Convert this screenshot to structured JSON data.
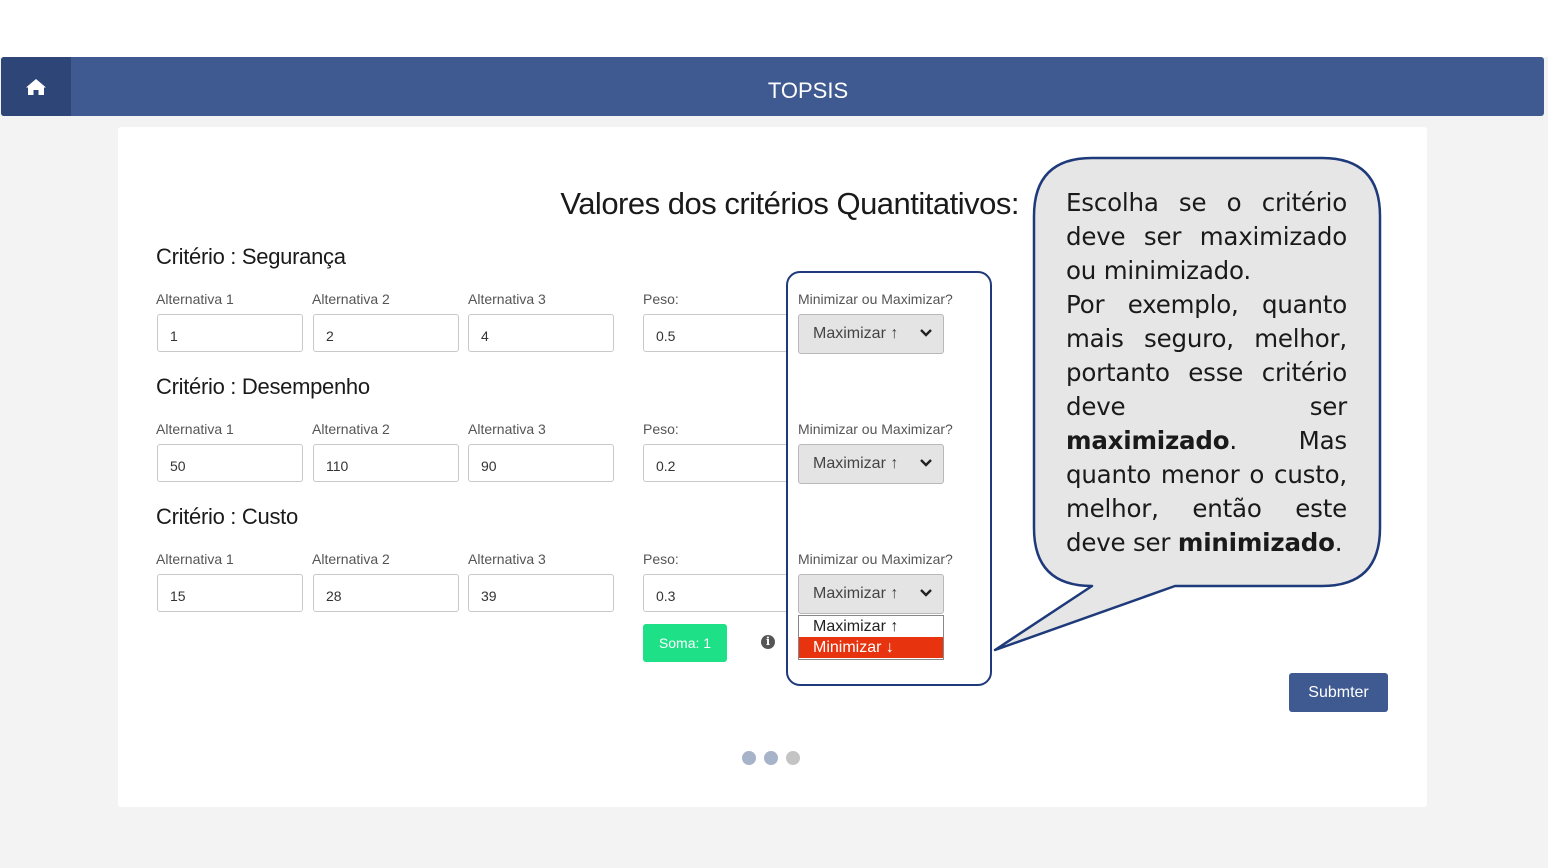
{
  "app": {
    "title": "TOPSIS",
    "home_icon": "home-icon"
  },
  "page": {
    "heading": "Valores dos critérios Quantitativos:"
  },
  "criteria": [
    {
      "title": "Critério : Segurança",
      "labels": {
        "alt1": "Alternativa 1",
        "alt2": "Alternativa 2",
        "alt3": "Alternativa 3",
        "peso": "Peso:",
        "minmax": "Minimizar ou Maximizar?"
      },
      "values": {
        "alt1": "1",
        "alt2": "2",
        "alt3": "4",
        "peso": "0.5"
      },
      "direction": "Maximizar ↑"
    },
    {
      "title": "Critério : Desempenho",
      "labels": {
        "alt1": "Alternativa 1",
        "alt2": "Alternativa 2",
        "alt3": "Alternativa 3",
        "peso": "Peso:",
        "minmax": "Minimizar ou Maximizar?"
      },
      "values": {
        "alt1": "50",
        "alt2": "110",
        "alt3": "90",
        "peso": "0.2"
      },
      "direction": "Maximizar ↑"
    },
    {
      "title": "Critério : Custo",
      "labels": {
        "alt1": "Alternativa 1",
        "alt2": "Alternativa 2",
        "alt3": "Alternativa 3",
        "peso": "Peso:",
        "minmax": "Minimizar ou Maximizar?"
      },
      "values": {
        "alt1": "15",
        "alt2": "28",
        "alt3": "39",
        "peso": "0.3"
      },
      "direction": "Maximizar ↑"
    }
  ],
  "dropdown": {
    "options": [
      "Maximizar ↑",
      "Minimizar ↓"
    ],
    "highlighted": "Minimizar ↓"
  },
  "soma": {
    "label": "Soma: 1"
  },
  "submit": {
    "label": "Submter"
  },
  "pagination": {
    "dots": 3
  },
  "callout": {
    "p1": "Escolha se o critério deve ser maximizado ou minimizado.",
    "p2_a": "Por exemplo, quanto mais seguro, melhor, portanto esse critério deve ser ",
    "p2_b": "maximizado",
    "p2_c": ".",
    "p3_a": "Mas quanto menor o custo, melhor, então este deve ser ",
    "p3_b": "minimizado",
    "p3_c": "."
  },
  "colors": {
    "navbar": "#3f5a91",
    "home": "#2d4577",
    "soma": "#1de087",
    "minimize": "#e8330f",
    "callout_border": "#1e3a7a",
    "callout_fill": "#e6e6e6"
  }
}
